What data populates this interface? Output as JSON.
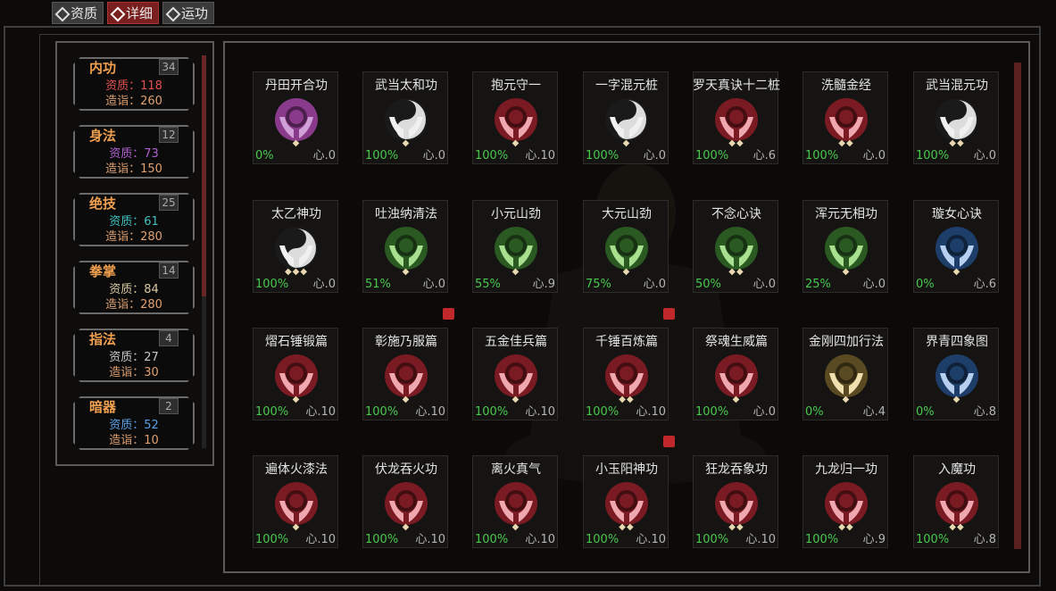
{
  "tabs": [
    {
      "label": "资质",
      "active": false
    },
    {
      "label": "详细",
      "active": true
    },
    {
      "label": "运功",
      "active": false
    }
  ],
  "categories": [
    {
      "title": "内功",
      "count": "34",
      "zizhi_label": "资质：",
      "zizhi": "118",
      "zizhi_color": "#e05050",
      "zaoyi_label": "造诣：",
      "zaoyi": "260"
    },
    {
      "title": "身法",
      "count": "12",
      "zizhi_label": "资质：",
      "zizhi": "73",
      "zizhi_color": "#b060d0",
      "zaoyi_label": "造诣：",
      "zaoyi": "150"
    },
    {
      "title": "绝技",
      "count": "25",
      "zizhi_label": "资质：",
      "zizhi": "61",
      "zizhi_color": "#40c0c0",
      "zaoyi_label": "造诣：",
      "zaoyi": "280"
    },
    {
      "title": "拳掌",
      "count": "14",
      "zizhi_label": "资质：",
      "zizhi": "84",
      "zizhi_color": "#d8c8a0",
      "zaoyi_label": "造诣：",
      "zaoyi": "280"
    },
    {
      "title": "指法",
      "count": "4",
      "zizhi_label": "资质：",
      "zizhi": "27",
      "zizhi_color": "#c8c8c8",
      "zaoyi_label": "造诣：",
      "zaoyi": "30"
    },
    {
      "title": "暗器",
      "count": "2",
      "zizhi_label": "资质：",
      "zizhi": "52",
      "zizhi_color": "#5aa0e8",
      "zaoyi_label": "造诣：",
      "zaoyi": "10"
    }
  ],
  "skills": [
    {
      "name": "丹田开合功",
      "icon": "purple-hands-icon",
      "color": "#8a3a8a",
      "hand": "#d0a0d8",
      "diamonds": "◆",
      "pct": "0%",
      "xin": "心.0",
      "flag": false
    },
    {
      "name": "武当太和功",
      "icon": "yinyang-hands-icon",
      "color": "#3a3a3a",
      "hand": "#f0f0f0",
      "diamonds": "◆",
      "pct": "100%",
      "xin": "心.0",
      "flag": false
    },
    {
      "name": "抱元守一",
      "icon": "red-hands-icon",
      "color": "#7a1a22",
      "hand": "#f0a8b0",
      "diamonds": "◆",
      "pct": "100%",
      "xin": "心.10",
      "flag": false
    },
    {
      "name": "一字混元桩",
      "icon": "yinyang-hands-icon",
      "color": "#3a3a3a",
      "hand": "#f0f0f0",
      "diamonds": "◆",
      "pct": "100%",
      "xin": "心.0",
      "flag": false
    },
    {
      "name": "罗天真诀十二桩",
      "icon": "red-hands-icon",
      "color": "#7a1a22",
      "hand": "#f0a8b0",
      "diamonds": "◆◆",
      "pct": "100%",
      "xin": "心.6",
      "flag": false
    },
    {
      "name": "洗髓金经",
      "icon": "red-hands-icon",
      "color": "#7a1a22",
      "hand": "#f0a8b0",
      "diamonds": "◆◆",
      "pct": "100%",
      "xin": "心.0",
      "flag": false
    },
    {
      "name": "武当混元功",
      "icon": "yinyang-hands-icon",
      "color": "#3a3a3a",
      "hand": "#f0f0f0",
      "diamonds": "◆◆",
      "pct": "100%",
      "xin": "心.0",
      "flag": false
    },
    {
      "name": "太乙神功",
      "icon": "yinyang-hands-icon",
      "color": "#3a3a3a",
      "hand": "#f0f0f0",
      "diamonds": "◆◆◆",
      "pct": "100%",
      "xin": "心.0",
      "flag": false
    },
    {
      "name": "吐浊纳清法",
      "icon": "green-hands-icon",
      "color": "#2a5a22",
      "hand": "#a8e090",
      "diamonds": "◆",
      "pct": "51%",
      "xin": "心.0",
      "flag": false
    },
    {
      "name": "小元山劲",
      "icon": "green-hands-icon",
      "color": "#2a5a22",
      "hand": "#a8e090",
      "diamonds": "◆",
      "pct": "55%",
      "xin": "心.9",
      "flag": false
    },
    {
      "name": "大元山劲",
      "icon": "green-hands-icon",
      "color": "#2a5a22",
      "hand": "#a8e090",
      "diamonds": "◆",
      "pct": "75%",
      "xin": "心.0",
      "flag": false
    },
    {
      "name": "不念心诀",
      "icon": "green-hands-icon",
      "color": "#2a5a22",
      "hand": "#a8e090",
      "diamonds": "◆◆",
      "pct": "50%",
      "xin": "心.0",
      "flag": false
    },
    {
      "name": "浑元无相功",
      "icon": "green-hands-icon",
      "color": "#2a5a22",
      "hand": "#a8e090",
      "diamonds": "◆",
      "pct": "25%",
      "xin": "心.0",
      "flag": false
    },
    {
      "name": "璇女心诀",
      "icon": "blue-hands-icon",
      "color": "#1e3e6a",
      "hand": "#b8d0f0",
      "diamonds": "◆",
      "pct": "0%",
      "xin": "心.6",
      "flag": false
    },
    {
      "name": "熠石锤锻篇",
      "icon": "red-hands-icon",
      "color": "#7a1a22",
      "hand": "#f0a8b0",
      "diamonds": "◆",
      "pct": "100%",
      "xin": "心.10",
      "flag": false
    },
    {
      "name": "彰施乃服篇",
      "icon": "red-hands-icon",
      "color": "#7a1a22",
      "hand": "#f0a8b0",
      "diamonds": "◆",
      "pct": "100%",
      "xin": "心.10",
      "flag": true
    },
    {
      "name": "五金佳兵篇",
      "icon": "red-hands-icon",
      "color": "#7a1a22",
      "hand": "#f0a8b0",
      "diamonds": "◆",
      "pct": "100%",
      "xin": "心.10",
      "flag": false
    },
    {
      "name": "千锤百炼篇",
      "icon": "red-hands-icon",
      "color": "#7a1a22",
      "hand": "#f0a8b0",
      "diamonds": "◆◆",
      "pct": "100%",
      "xin": "心.10",
      "flag": true
    },
    {
      "name": "祭魂生威篇",
      "icon": "red-hands-icon",
      "color": "#7a1a22",
      "hand": "#f0a8b0",
      "diamonds": "◆",
      "pct": "100%",
      "xin": "心.0",
      "flag": false
    },
    {
      "name": "金刚四加行法",
      "icon": "gold-hands-icon",
      "color": "#5a4a22",
      "hand": "#f0e0b0",
      "diamonds": "◆",
      "pct": "0%",
      "xin": "心.4",
      "flag": false
    },
    {
      "name": "界青四象图",
      "icon": "blue-hands-icon",
      "color": "#1e3e6a",
      "hand": "#b8d0f0",
      "diamonds": "◆",
      "pct": "0%",
      "xin": "心.8",
      "flag": false
    },
    {
      "name": "遍体火漆法",
      "icon": "red-hands-icon",
      "color": "#7a1a22",
      "hand": "#f0a8b0",
      "diamonds": "◆",
      "pct": "100%",
      "xin": "心.10",
      "flag": false
    },
    {
      "name": "伏龙吞火功",
      "icon": "red-hands-icon",
      "color": "#7a1a22",
      "hand": "#f0a8b0",
      "diamonds": "◆",
      "pct": "100%",
      "xin": "心.10",
      "flag": false
    },
    {
      "name": "离火真气",
      "icon": "red-hands-icon",
      "color": "#7a1a22",
      "hand": "#f0a8b0",
      "diamonds": "◆",
      "pct": "100%",
      "xin": "心.10",
      "flag": false
    },
    {
      "name": "小玉阳神功",
      "icon": "red-hands-icon",
      "color": "#7a1a22",
      "hand": "#f0a8b0",
      "diamonds": "◆◆",
      "pct": "100%",
      "xin": "心.10",
      "flag": true
    },
    {
      "name": "狂龙吞象功",
      "icon": "red-hands-icon",
      "color": "#7a1a22",
      "hand": "#f0a8b0",
      "diamonds": "◆◆",
      "pct": "100%",
      "xin": "心.10",
      "flag": false
    },
    {
      "name": "九龙归一功",
      "icon": "red-hands-icon",
      "color": "#7a1a22",
      "hand": "#f0a8b0",
      "diamonds": "◆◆",
      "pct": "100%",
      "xin": "心.9",
      "flag": false
    },
    {
      "name": "入魔功",
      "icon": "red-hands-icon",
      "color": "#7a1a22",
      "hand": "#f0a8b0",
      "diamonds": "◆◆",
      "pct": "100%",
      "xin": "心.8",
      "flag": false
    }
  ]
}
